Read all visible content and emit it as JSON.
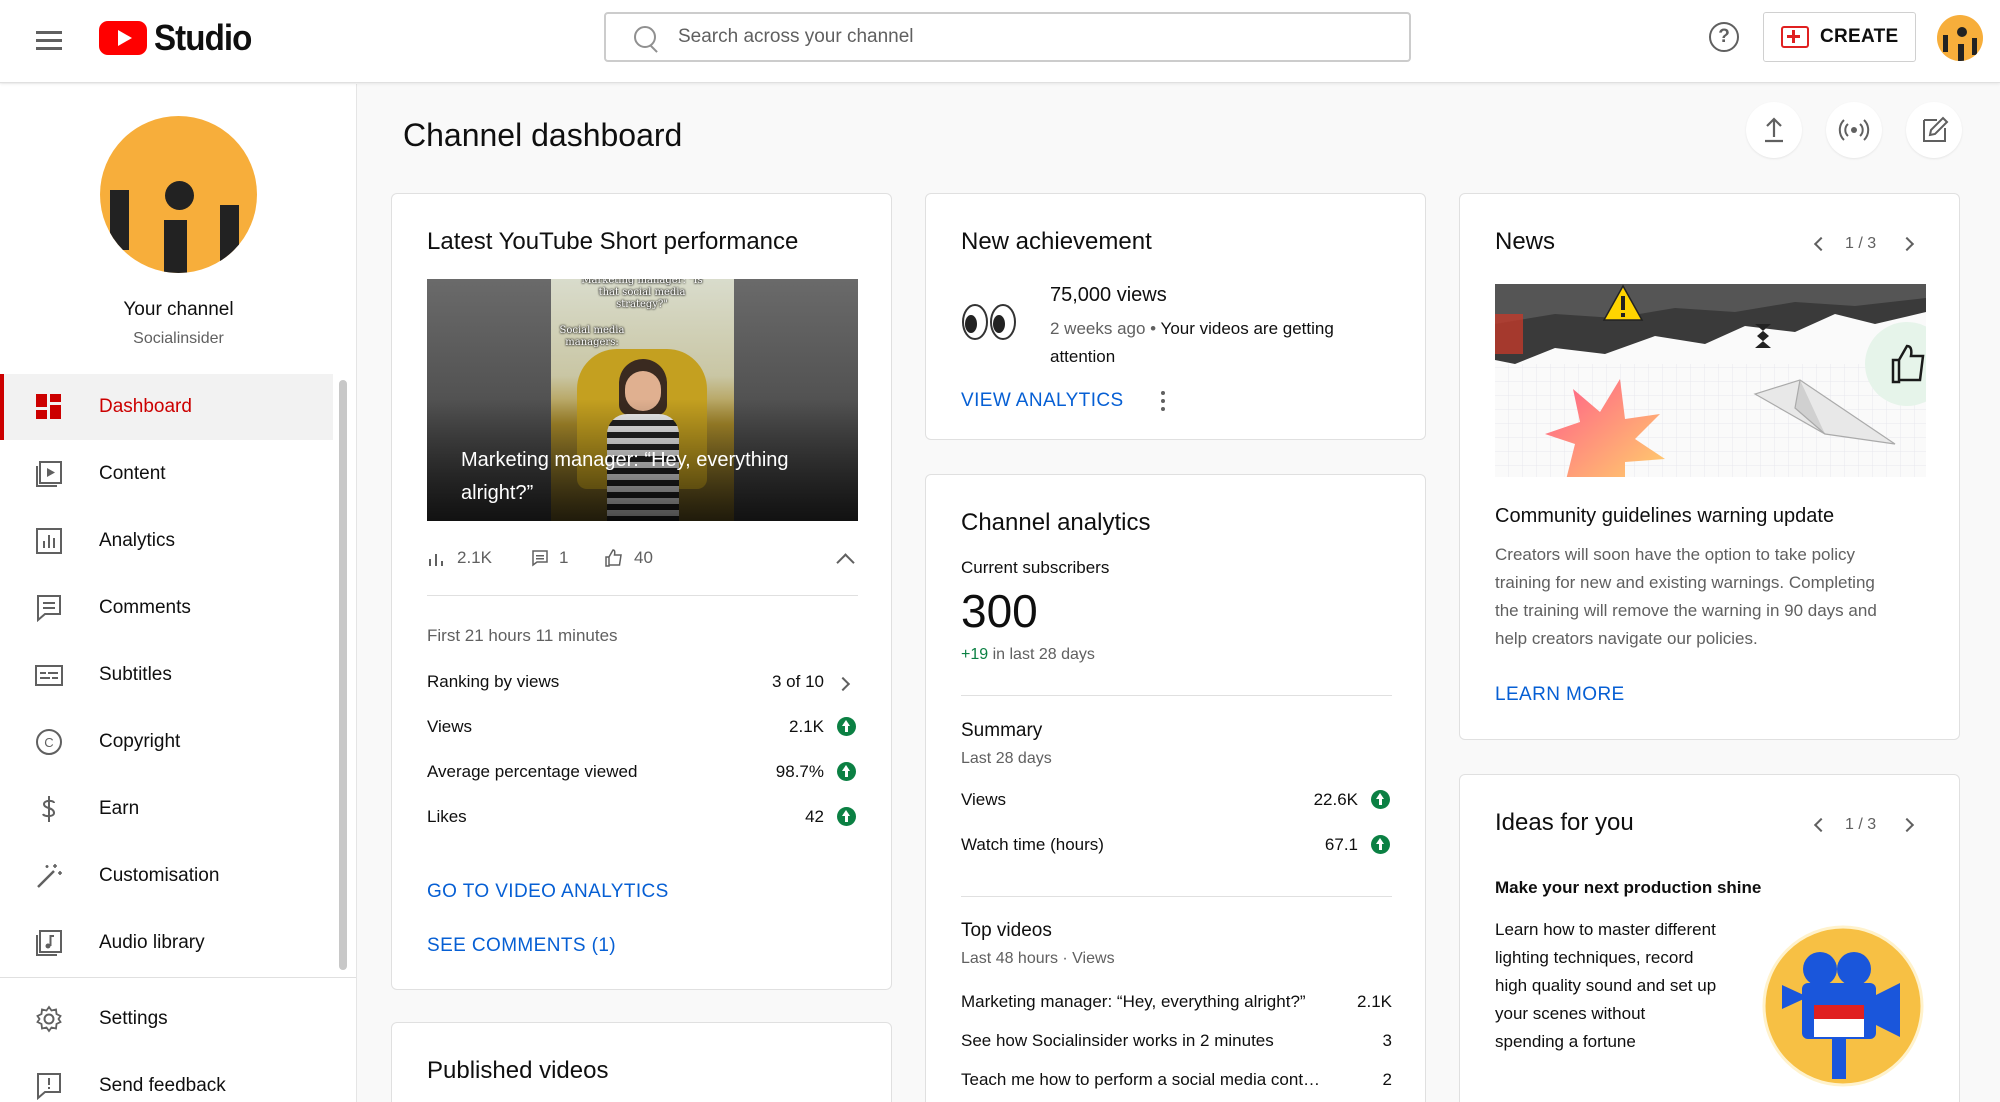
{
  "topbar": {
    "logo_text": "Studio",
    "search_placeholder": "Search across your channel",
    "create_label": "CREATE"
  },
  "sidebar": {
    "channel_name": "Your channel",
    "channel_handle": "Socialinsider",
    "items": [
      {
        "label": "Dashboard",
        "icon": "dashboard-icon",
        "active": true
      },
      {
        "label": "Content",
        "icon": "content-icon"
      },
      {
        "label": "Analytics",
        "icon": "analytics-icon"
      },
      {
        "label": "Comments",
        "icon": "comments-icon"
      },
      {
        "label": "Subtitles",
        "icon": "subtitles-icon"
      },
      {
        "label": "Copyright",
        "icon": "copyright-icon"
      },
      {
        "label": "Earn",
        "icon": "earn-icon"
      },
      {
        "label": "Customisation",
        "icon": "customisation-icon"
      },
      {
        "label": "Audio library",
        "icon": "audio-library-icon"
      }
    ],
    "bottom_items": [
      {
        "label": "Settings",
        "icon": "settings-icon"
      },
      {
        "label": "Send feedback",
        "icon": "feedback-icon"
      }
    ]
  },
  "page": {
    "title": "Channel dashboard"
  },
  "short_card": {
    "title": "Latest YouTube Short performance",
    "thumbnail_top_text": "Marketing manager: \"Is that social media strategy?\"",
    "thumbnail_mid_text": "Social media managers:",
    "caption": "Marketing manager: “Hey, everything alright?”",
    "stats": {
      "views": "2.1K",
      "comments": "1",
      "likes": "40"
    },
    "period": "First 21 hours 11 minutes",
    "rows": [
      {
        "label": "Ranking by views",
        "value": "3 of 10"
      },
      {
        "label": "Views",
        "value": "2.1K"
      },
      {
        "label": "Average percentage viewed",
        "value": "98.7%"
      },
      {
        "label": "Likes",
        "value": "42"
      }
    ],
    "link_analytics": "GO TO VIDEO ANALYTICS",
    "link_comments": "SEE COMMENTS (1)"
  },
  "published_card": {
    "title": "Published videos"
  },
  "achievement_card": {
    "title": "New achievement",
    "headline": "75,000 views",
    "time": "2 weeks ago",
    "desc_line1": "Your videos are getting",
    "desc_line2": "attention",
    "link": "VIEW ANALYTICS"
  },
  "analytics_card": {
    "title": "Channel analytics",
    "subs_label": "Current subscribers",
    "subs_value": "300",
    "subs_change": "+19",
    "subs_change_suffix": "in last 28 days",
    "summary_title": "Summary",
    "summary_period": "Last 28 days",
    "summary_rows": [
      {
        "label": "Views",
        "value": "22.6K"
      },
      {
        "label": "Watch time (hours)",
        "value": "67.1"
      }
    ],
    "top_title": "Top videos",
    "top_period": "Last 48 hours · Views",
    "top_rows": [
      {
        "label": "Marketing manager: “Hey, everything alright?”",
        "value": "2.1K"
      },
      {
        "label": "See how Socialinsider works in 2 minutes",
        "value": "3"
      },
      {
        "label": "Teach me how to perform a social media cont…",
        "value": "2"
      }
    ]
  },
  "news_card": {
    "title": "News",
    "pager": "1 / 3",
    "headline": "Community guidelines warning update",
    "body_lines": [
      "Creators will soon have the option to take policy",
      "training for new and existing warnings. Completing",
      "the training will remove the warning in 90 days and",
      "help creators navigate our policies."
    ],
    "link": "LEARN MORE"
  },
  "ideas_card": {
    "title": "Ideas for you",
    "pager": "1 / 3",
    "headline": "Make your next production shine",
    "body_lines": [
      "Learn how to master different",
      "lighting techniques, record",
      "high quality sound and set up",
      "your scenes without",
      "spending a fortune"
    ]
  },
  "colors": {
    "brand_red": "#ff0000",
    "active_red": "#cc0000",
    "link_blue": "#065fd4",
    "positive_green": "#0b8043",
    "avatar_orange": "#f7ae3b"
  }
}
